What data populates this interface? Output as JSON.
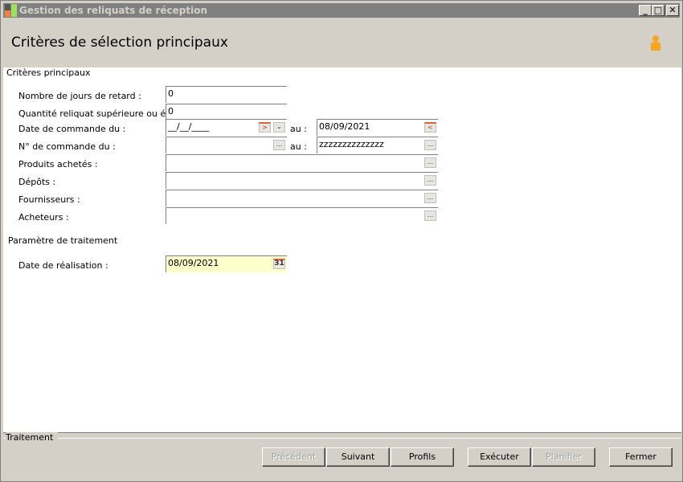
{
  "window": {
    "title": "Gestion des reliquats de réception"
  },
  "header": {
    "title": "Critères de sélection principaux"
  },
  "section1": {
    "title": "Critères principaux",
    "rows": [
      {
        "label": "Nombre de jours de retard :",
        "value": "0"
      },
      {
        "label": "Quantité reliquat supérieure ou égale :",
        "value": "0"
      },
      {
        "label": "Date de commande du :",
        "value": "__/__/____",
        "to_label": "au :",
        "to_value": "08/09/2021"
      },
      {
        "label": "N° de commande du :",
        "value": "",
        "to_label": "au :",
        "to_value": "zzzzzzzzzzzzzz"
      },
      {
        "label": "Produits achetés :",
        "value": ""
      },
      {
        "label": "Dépôts :",
        "value": ""
      },
      {
        "label": "Fournisseurs :",
        "value": ""
      },
      {
        "label": "Acheteurs :",
        "value": ""
      }
    ]
  },
  "section2": {
    "title": "Paramètre de traitement",
    "label": "Date de réalisation :",
    "value": "08/09/2021",
    "calendar_day": "31"
  },
  "footer": {
    "title": "Traitement",
    "buttons": {
      "previous": "Précédent",
      "next": "Suivant",
      "profiles": "Profils",
      "execute": "Exécuter",
      "schedule": "Planifier",
      "close": "Fermer"
    }
  },
  "browse_label": "...",
  "colors": {
    "highlight_field": "#ffffcc",
    "title_bar": "#808080"
  }
}
